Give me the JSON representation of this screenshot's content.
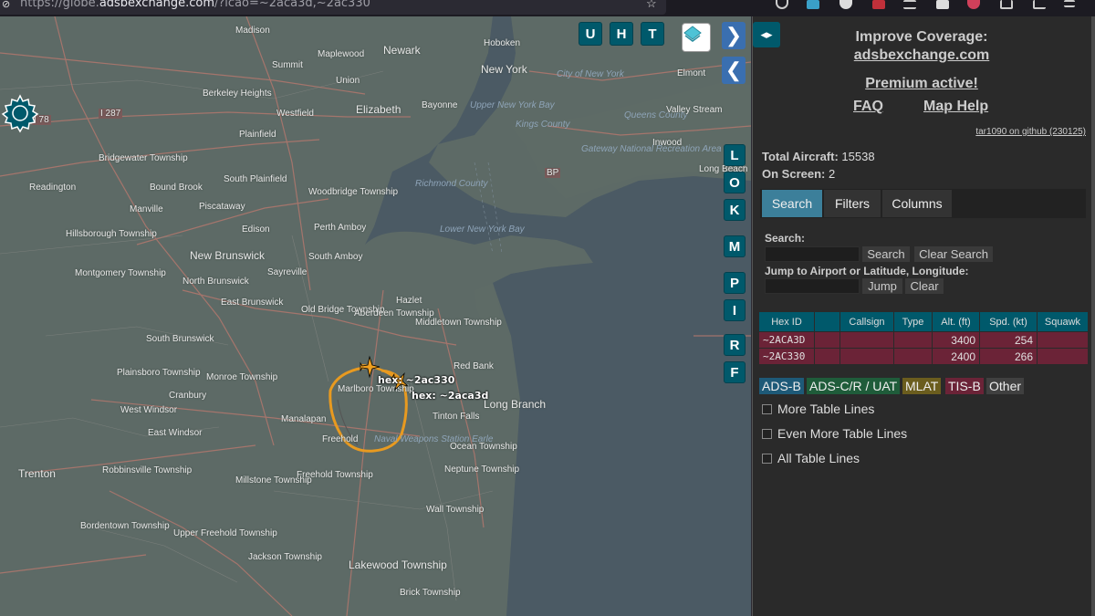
{
  "browser": {
    "url_prefix": "https://globe.",
    "url_domain": "adsbexchange.com",
    "url_suffix": "/?icao=~2aca3d,~2ac330"
  },
  "map": {
    "places": [
      {
        "name": "Madison"
      },
      {
        "name": "Newark"
      },
      {
        "name": "Hoboken"
      },
      {
        "name": "New York"
      },
      {
        "name": "Summit"
      },
      {
        "name": "Maplewood"
      },
      {
        "name": "Union"
      },
      {
        "name": "City of New York"
      },
      {
        "name": "Berkeley Heights"
      },
      {
        "name": "Elizabeth"
      },
      {
        "name": "Bayonne"
      },
      {
        "name": "Westfield"
      },
      {
        "name": "Plainfield"
      },
      {
        "name": "Bridgewater Township"
      },
      {
        "name": "South Plainfield"
      },
      {
        "name": "Bound Brook"
      },
      {
        "name": "Readington"
      },
      {
        "name": "Woodbridge Township"
      },
      {
        "name": "Manville"
      },
      {
        "name": "Piscataway"
      },
      {
        "name": "Edison"
      },
      {
        "name": "Perth Amboy"
      },
      {
        "name": "Hillsborough Township"
      },
      {
        "name": "New Brunswick"
      },
      {
        "name": "South Amboy"
      },
      {
        "name": "Sayreville"
      },
      {
        "name": "Montgomery Township"
      },
      {
        "name": "North Brunswick"
      },
      {
        "name": "East Brunswick"
      },
      {
        "name": "Old Bridge Township"
      },
      {
        "name": "Aberdeen Township"
      },
      {
        "name": "Hazlet"
      },
      {
        "name": "Middletown Township"
      },
      {
        "name": "South Brunswick"
      },
      {
        "name": "Plainsboro Township"
      },
      {
        "name": "Monroe Township"
      },
      {
        "name": "Marlboro Township"
      },
      {
        "name": "Red Bank"
      },
      {
        "name": "Long Branch"
      },
      {
        "name": "Cranbury"
      },
      {
        "name": "West Windsor"
      },
      {
        "name": "Manalapan"
      },
      {
        "name": "East Windsor"
      },
      {
        "name": "Tinton Falls"
      },
      {
        "name": "Freehold"
      },
      {
        "name": "Ocean Township"
      },
      {
        "name": "Trenton"
      },
      {
        "name": "Robbinsville Township"
      },
      {
        "name": "Freehold Township"
      },
      {
        "name": "Neptune Township"
      },
      {
        "name": "Millstone Township"
      },
      {
        "name": "Wall Township"
      },
      {
        "name": "Bordentown Township"
      },
      {
        "name": "Upper Freehold Township"
      },
      {
        "name": "Jackson Township"
      },
      {
        "name": "Lakewood Township"
      },
      {
        "name": "Brick Township"
      },
      {
        "name": "Kings County"
      },
      {
        "name": "Queens County"
      },
      {
        "name": "Inwood"
      },
      {
        "name": "Long Beach"
      },
      {
        "name": "Elmont"
      },
      {
        "name": "Valley Stream"
      },
      {
        "name": "Gateway National Recreation Area"
      },
      {
        "name": "Richmond County"
      },
      {
        "name": "Lower New York Bay"
      },
      {
        "name": "Upper New York Bay"
      },
      {
        "name": "Naval Weapons Station Earle"
      }
    ],
    "road_shields": [
      "I 78",
      "I 287",
      "BP"
    ],
    "aircraft": [
      {
        "label": "hex: ~2ac330"
      },
      {
        "label": "hex: ~2aca3d"
      }
    ],
    "buttons": {
      "u": "U",
      "h": "H",
      "t": "T",
      "l": "L",
      "o": "O",
      "k": "K",
      "m": "M",
      "p": "P",
      "i": "I",
      "r": "R",
      "f": "F"
    }
  },
  "sidebar": {
    "expand_label": "◂▸",
    "improve_line1": "Improve Coverage:",
    "improve_link": "adsbexchange.com",
    "premium": "Premium active!",
    "faq": "FAQ",
    "map_help": "Map Help",
    "github": "tar1090 on github (230125)",
    "total_aircraft_label": "Total Aircraft:",
    "total_aircraft": "15538",
    "on_screen_label": "On Screen:",
    "on_screen": "2",
    "tabs": [
      "Search",
      "Filters",
      "Columns"
    ],
    "search_label": "Search:",
    "search_btn": "Search",
    "clear_search_btn": "Clear Search",
    "jump_label": "Jump to Airport or Latitude, Longitude:",
    "jump_btn": "Jump",
    "clear_btn": "Clear",
    "table": {
      "headers": [
        "Hex ID",
        "",
        "Callsign",
        "Type",
        "Alt. (ft)",
        "Spd. (kt)",
        "Squawk"
      ],
      "rows": [
        [
          "~2ACA3D",
          "",
          "",
          "",
          "3400",
          "254",
          ""
        ],
        [
          "~2AC330",
          "",
          "",
          "",
          "2400",
          "266",
          ""
        ]
      ]
    },
    "legend": [
      {
        "label": "ADS-B",
        "color": "#1e5a78"
      },
      {
        "label": "ADS-C/R / UAT",
        "color": "#1f5c3a"
      },
      {
        "label": "MLAT",
        "color": "#6b5d1e"
      },
      {
        "label": "TIS-B",
        "color": "#6b2337"
      },
      {
        "label": "Other",
        "color": "#404040"
      }
    ],
    "checkboxes": [
      "More Table Lines",
      "Even More Table Lines",
      "All Table Lines"
    ]
  }
}
